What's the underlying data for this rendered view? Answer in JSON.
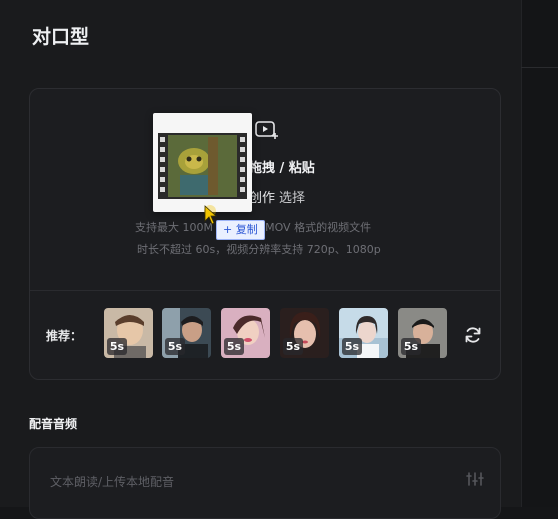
{
  "panel": {
    "title": "对口型"
  },
  "upload": {
    "hint": "拖拽 / 粘贴",
    "sub_text": "创作",
    "sub_link": "选择",
    "desc_line1": "支持最大 100M 的 MP4、MOV 格式的视频文件",
    "desc_line2": "时长不超过 60s，视频分辨率支持 720p、1080p",
    "copy_tooltip": "+ 复制"
  },
  "recommend": {
    "label": "推荐：",
    "items": [
      {
        "duration": "5s"
      },
      {
        "duration": "5s"
      },
      {
        "duration": "5s"
      },
      {
        "duration": "5s"
      },
      {
        "duration": "5s"
      },
      {
        "duration": "5s"
      }
    ]
  },
  "audio": {
    "section_title": "配音音频",
    "placeholder": "文本朗读/上传本地配音"
  },
  "colors": {
    "background": "#1a1b1d",
    "card_border": "#2c2d31",
    "tooltip_text": "#2a55d4",
    "cursor": "#f2c400"
  }
}
